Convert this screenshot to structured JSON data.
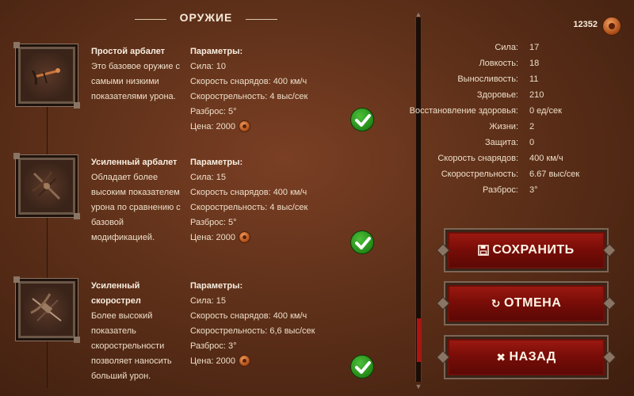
{
  "header": {
    "title": "ОРУЖИЕ"
  },
  "currency": {
    "amount": "12352",
    "icon": "coin-icon"
  },
  "weapons": [
    {
      "name": "Простой арбалет",
      "description": "Это базовое оружие с самыми низкими показателями урона.",
      "params_title": "Параметры:",
      "strength": "Сила: 10",
      "projectile_speed": "Скорость снарядов: 400 км/ч",
      "rate": "Скорострельность: 4 выс/сек",
      "spread": "Разброс: 5°",
      "price": "Цена: 2000",
      "owned": true
    },
    {
      "name": "Усиленный арбалет",
      "description": "Обладает более высоким показателем урона по сравнению с базовой модификацией.",
      "params_title": "Параметры:",
      "strength": "Сила: 15",
      "projectile_speed": "Скорость снарядов: 400 км/ч",
      "rate": "Скорострельность: 4 выс/сек",
      "spread": "Разброс: 5°",
      "price": "Цена: 2000",
      "owned": true
    },
    {
      "name": "Усиленный скорострел",
      "description": "Более высокий показатель скорострельности позволяет наносить больший урон.",
      "params_title": "Параметры:",
      "strength": "Сила: 15",
      "projectile_speed": "Скорость снарядов: 400 км/ч",
      "rate": "Скорострельность: 6,6 выс/сек",
      "spread": "Разброс: 3°",
      "price": "Цена: 2000",
      "owned": true
    }
  ],
  "stats": [
    {
      "label": "Сила:",
      "value": "17"
    },
    {
      "label": "Ловкость:",
      "value": "18"
    },
    {
      "label": "Выносливость:",
      "value": "11"
    },
    {
      "label": "Здоровье:",
      "value": "210"
    },
    {
      "label": "Восстановление здоровья:",
      "value": "0 ед/сек"
    },
    {
      "label": "Жизни:",
      "value": "2"
    },
    {
      "label": "Защита:",
      "value": "0"
    },
    {
      "label": "Скорость снарядов:",
      "value": "400 км/ч"
    },
    {
      "label": "Скорострельность:",
      "value": "6.67 выс/сек"
    },
    {
      "label": "Разброс:",
      "value": "3°"
    }
  ],
  "buttons": {
    "save": "СОХРАНИТЬ",
    "cancel": "ОТМЕНА",
    "back": "НАЗАД"
  },
  "colors": {
    "background": "#5e3019",
    "button": "#9e1a12",
    "check": "#238a18",
    "scroll_thumb": "#b3120e"
  }
}
